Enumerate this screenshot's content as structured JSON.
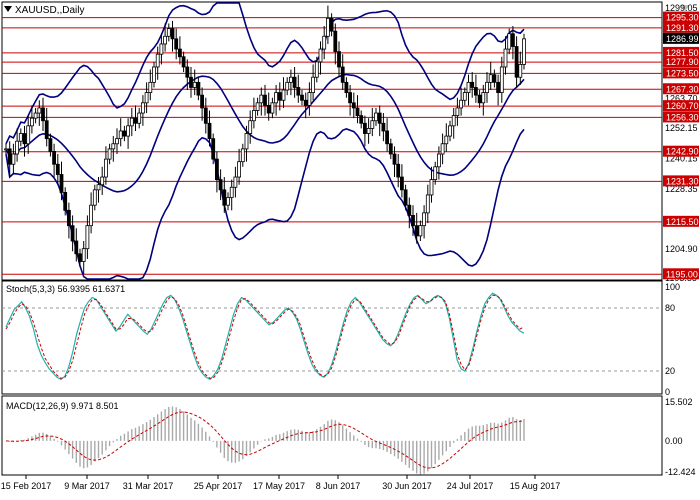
{
  "window": {
    "title": "XAUUSD,,Daily"
  },
  "colors": {
    "frame": "#000000",
    "grid_line": "#cc0000",
    "bollinger": "#000080",
    "price_tag_bg": "#cc0000",
    "current_tag_bg": "#000000",
    "stoch_main": "#20b2aa",
    "stoch_signal": "#cc0000",
    "macd_hist": "#a9a9a9",
    "macd_signal": "#cc0000",
    "candle": "#000000"
  },
  "icons": {
    "header": "triangle-down-icon",
    "scroll": "scroll-shift-icon"
  },
  "price_axis": {
    "gray_labels": [
      "1299.05",
      "1263.70",
      "1252.15",
      "1240.15",
      "1228.35",
      "1204.90",
      "1193.55"
    ],
    "red_labels": [
      "1295.30",
      "1291.30",
      "1281.50",
      "1277.90",
      "1273.50",
      "1267.30",
      "1260.70",
      "1256.30",
      "1242.90",
      "1231.30",
      "1215.50",
      "1195.00"
    ],
    "current_price": "1286.99"
  },
  "indicators": {
    "stoch": {
      "label": "Stoch(5,3,3) 56.9395 61.6371",
      "levels": [
        "100",
        "80",
        "20",
        "0"
      ]
    },
    "macd": {
      "label": "MACD(12,26,9) 9.971 8.501",
      "levels": [
        "15.502",
        "0.00",
        "-12.424"
      ]
    }
  },
  "time_axis": [
    "15 Feb 2017",
    "9 Mar 2017",
    "31 Mar 2017",
    "25 Apr 2017",
    "17 May 2017",
    "8 Jun 2017",
    "30 Jun 2017",
    "24 Jul 2017",
    "15 Aug 2017"
  ],
  "chart_data": {
    "type": "candlestick",
    "symbol": "XAUUSD",
    "timeframe": "Daily",
    "y_range": [
      1193.55,
      1299.05
    ],
    "horizontal_levels": [
      1295.3,
      1291.3,
      1281.5,
      1277.9,
      1273.5,
      1267.3,
      1260.7,
      1256.3,
      1242.9,
      1231.3,
      1215.5,
      1195.0
    ],
    "close_series": [
      1244,
      1238,
      1242,
      1247,
      1250,
      1246,
      1253,
      1256,
      1258,
      1260,
      1255,
      1248,
      1243,
      1238,
      1234,
      1227,
      1220,
      1214,
      1208,
      1203,
      1200,
      1205,
      1214,
      1222,
      1228,
      1230,
      1233,
      1240,
      1244,
      1246,
      1248,
      1251,
      1249,
      1253,
      1256,
      1254,
      1258,
      1262,
      1266,
      1270,
      1276,
      1281,
      1285,
      1288,
      1291,
      1287,
      1283,
      1280,
      1276,
      1272,
      1268,
      1270,
      1265,
      1260,
      1254,
      1248,
      1240,
      1232,
      1228,
      1222,
      1225,
      1229,
      1233,
      1239,
      1244,
      1250,
      1255,
      1259,
      1262,
      1265,
      1261,
      1258,
      1262,
      1266,
      1263,
      1267,
      1270,
      1272,
      1268,
      1265,
      1263,
      1261,
      1266,
      1272,
      1278,
      1283,
      1288,
      1295,
      1290,
      1282,
      1276,
      1270,
      1266,
      1262,
      1260,
      1257,
      1254,
      1250,
      1252,
      1255,
      1258,
      1254,
      1251,
      1246,
      1242,
      1238,
      1233,
      1228,
      1222,
      1218,
      1214,
      1210,
      1214,
      1219,
      1226,
      1232,
      1237,
      1242,
      1246,
      1249,
      1253,
      1257,
      1260,
      1263,
      1266,
      1270,
      1268,
      1265,
      1262,
      1266,
      1270,
      1273,
      1270,
      1266,
      1276,
      1283,
      1289,
      1284,
      1272,
      1277,
      1287
    ],
    "stoch_main": [
      62,
      70,
      78,
      82,
      86,
      80,
      72,
      60,
      45,
      35,
      28,
      22,
      18,
      14,
      12,
      15,
      24,
      38,
      55,
      68,
      80,
      86,
      90,
      88,
      82,
      76,
      70,
      64,
      58,
      62,
      68,
      74,
      70,
      66,
      62,
      58,
      55,
      60,
      68,
      76,
      84,
      90,
      92,
      88,
      80,
      70,
      58,
      46,
      34,
      24,
      18,
      14,
      12,
      16,
      22,
      32,
      46,
      60,
      74,
      84,
      90,
      88,
      84,
      80,
      76,
      72,
      68,
      64,
      66,
      70,
      74,
      78,
      80,
      76,
      70,
      60,
      48,
      36,
      26,
      20,
      16,
      14,
      18,
      26,
      38,
      52,
      66,
      78,
      86,
      90,
      86,
      80,
      74,
      68,
      62,
      56,
      50,
      46,
      44,
      48,
      56,
      66,
      76,
      84,
      90,
      92,
      88,
      84,
      86,
      90,
      92,
      90,
      84,
      70,
      50,
      30,
      22,
      20,
      28,
      42,
      58,
      72,
      84,
      90,
      94,
      92,
      88,
      80,
      72,
      66,
      62,
      58,
      56
    ],
    "stoch_signal": [
      60,
      66,
      74,
      80,
      84,
      82,
      76,
      66,
      54,
      42,
      32,
      26,
      20,
      16,
      13,
      14,
      20,
      30,
      45,
      60,
      74,
      82,
      88,
      88,
      84,
      78,
      72,
      66,
      60,
      60,
      64,
      70,
      70,
      68,
      64,
      60,
      57,
      58,
      64,
      72,
      80,
      87,
      91,
      89,
      83,
      74,
      62,
      50,
      38,
      28,
      20,
      16,
      13,
      14,
      19,
      28,
      40,
      54,
      68,
      80,
      88,
      89,
      86,
      82,
      78,
      74,
      70,
      66,
      65,
      68,
      72,
      76,
      79,
      77,
      72,
      64,
      52,
      40,
      30,
      22,
      17,
      15,
      17,
      23,
      34,
      48,
      62,
      74,
      83,
      88,
      87,
      82,
      76,
      70,
      64,
      58,
      52,
      48,
      45,
      47,
      53,
      63,
      73,
      82,
      88,
      91,
      89,
      86,
      86,
      89,
      91,
      90,
      86,
      74,
      56,
      36,
      26,
      21,
      26,
      38,
      54,
      68,
      80,
      88,
      92,
      92,
      89,
      82,
      75,
      68,
      64,
      60,
      62
    ]
  }
}
